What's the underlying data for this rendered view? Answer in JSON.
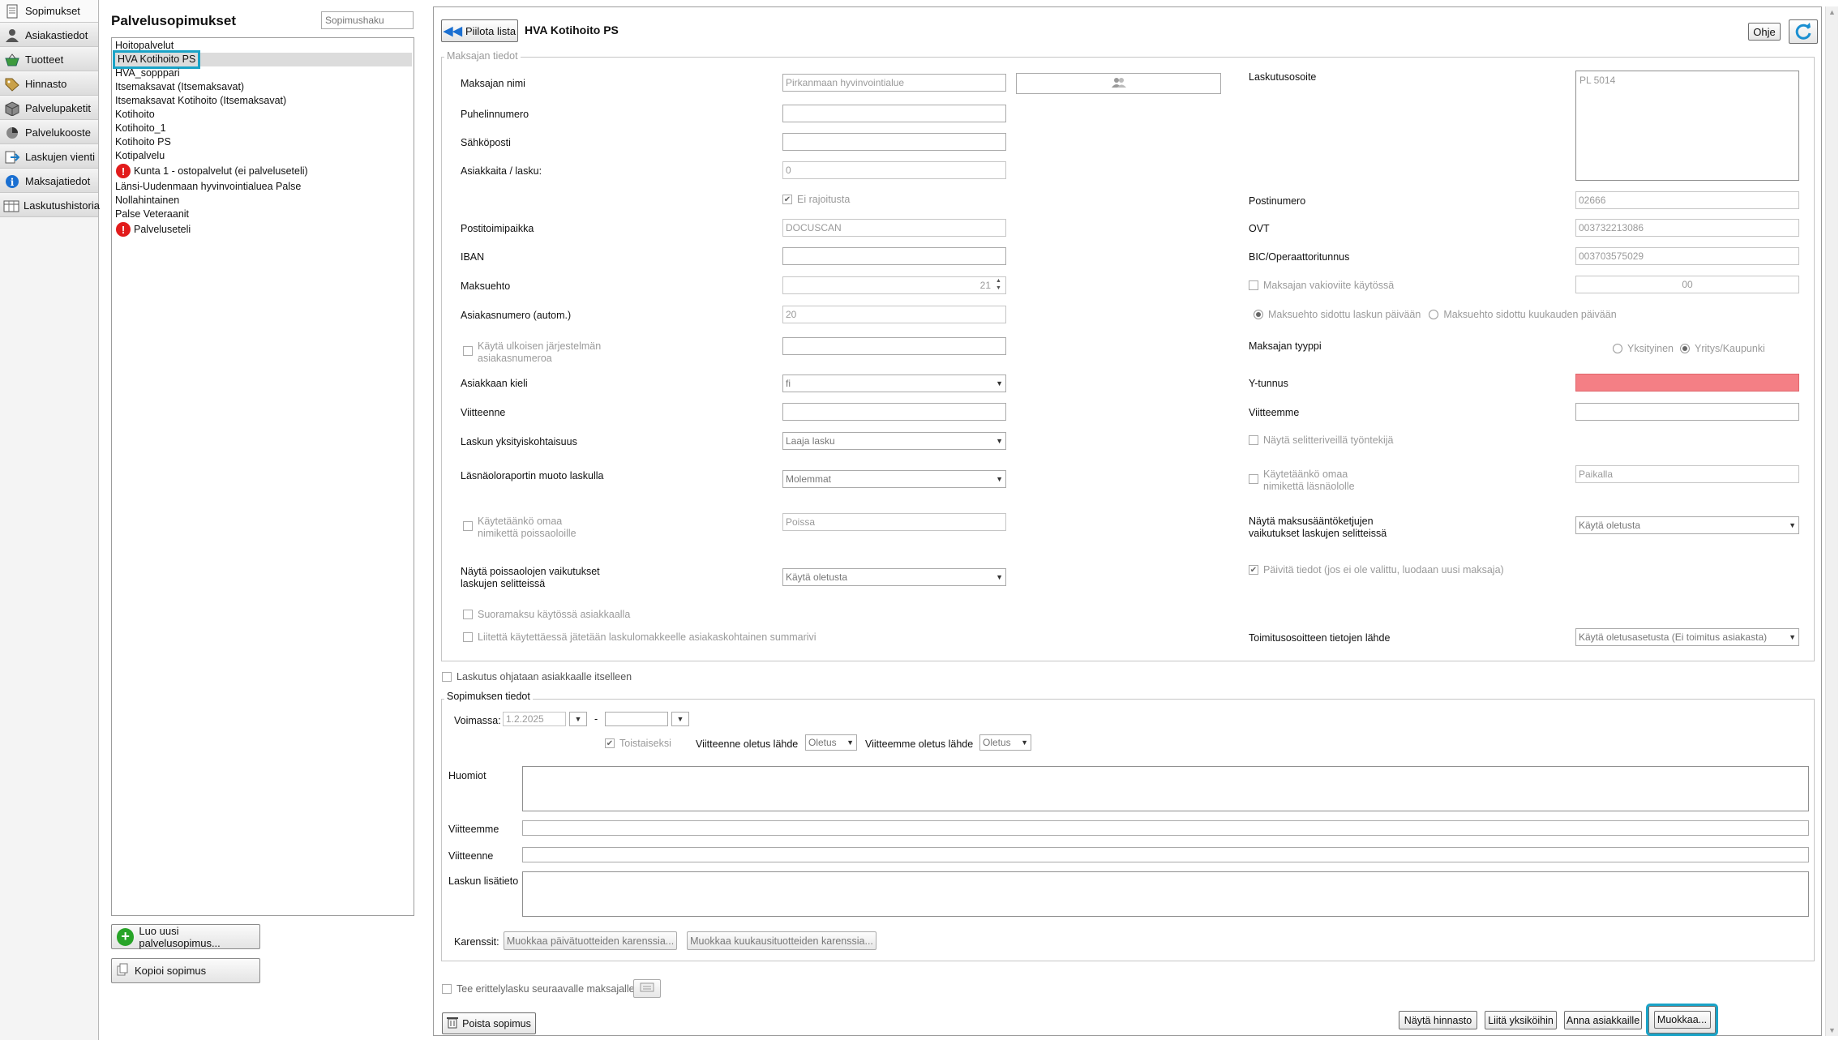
{
  "nav": {
    "items": [
      {
        "label": "Sopimukset",
        "icon": "document-icon"
      },
      {
        "label": "Asiakastiedot",
        "icon": "person-icon"
      },
      {
        "label": "Tuotteet",
        "icon": "basket-icon"
      },
      {
        "label": "Hinnasto",
        "icon": "price-tag-icon"
      },
      {
        "label": "Palvelupaketit",
        "icon": "package-icon"
      },
      {
        "label": "Palvelukooste",
        "icon": "pie-chart-icon"
      },
      {
        "label": "Laskujen vienti",
        "icon": "export-icon"
      },
      {
        "label": "Maksajatiedot",
        "icon": "info-icon"
      },
      {
        "label": "Laskutushistoria",
        "icon": "history-icon"
      }
    ]
  },
  "contracts": {
    "title": "Palvelusopimukset",
    "search_placeholder": "Sopimushaku",
    "items": [
      {
        "label": "Hoitopalvelut",
        "warning": false
      },
      {
        "label": "HVA Kotihoito PS",
        "warning": false,
        "selected": true
      },
      {
        "label": "HVA_sopppari",
        "warning": false
      },
      {
        "label": "Itsemaksavat (Itsemaksavat)",
        "warning": false
      },
      {
        "label": "Itsemaksavat Kotihoito (Itsemaksavat)",
        "warning": false
      },
      {
        "label": "Kotihoito",
        "warning": false
      },
      {
        "label": "Kotihoito_1",
        "warning": false
      },
      {
        "label": "Kotihoito PS",
        "warning": false
      },
      {
        "label": "Kotipalvelu",
        "warning": false
      },
      {
        "label": "Kunta 1 - ostopalvelut (ei palveluseteli)",
        "warning": true
      },
      {
        "label": "Länsi-Uudenmaan hyvinvointialuea Palse",
        "warning": false
      },
      {
        "label": "Nollahintainen",
        "warning": false
      },
      {
        "label": "Palse Veteraanit",
        "warning": false
      },
      {
        "label": "Palveluseteli",
        "warning": true
      }
    ],
    "new_button": "Luo uusi palvelusopimus...",
    "copy_button": "Kopioi sopimus"
  },
  "main": {
    "hide_list_button": "Piilota lista",
    "contract_title": "HVA Kotihoito PS",
    "help_button": "Ohje",
    "payer_legend": "Maksajan tiedot",
    "labels": {
      "payer_name": "Maksajan nimi",
      "phone": "Puhelinnumero",
      "email": "Sähköposti",
      "customers_per_invoice": "Asiakkaita / lasku:",
      "unlimited": "Ei rajoitusta",
      "city": "Postitoimipaikka",
      "iban": "IBAN",
      "payment_term": "Maksuehto",
      "customer_number": "Asiakasnumero (autom.)",
      "use_external": "Käytä ulkoisen järjestelmän asiakasnumeroa",
      "customer_language": "Asiakkaan kieli",
      "your_ref": "Viitteenne",
      "invoice_detail": "Laskun yksityiskohtaisuus",
      "attendance_format": "Läsnäoloraportin muoto laskulla",
      "own_name_absence": "Käytetäänkö omaa nimikettä poissaoloille",
      "show_absences": "Näytä poissaolojen vaikutukset laskujen selitteissä",
      "direct_debit": "Suoramaksu käytössä asiakkaalla",
      "attachment_summary": "Liitettä käytettäessä jätetään laskulomakkeelle asiakaskohtainen summarivi",
      "billing_address": "Laskutusosoite",
      "postal_code": "Postinumero",
      "ovt": "OVT",
      "bic": "BIC/Operaattoritunnus",
      "payer_default_ref": "Maksajan vakioviite käytössä",
      "term_invoice_date": "Maksuehto sidottu laskun päivään",
      "term_month_date": "Maksuehto sidottu kuukauden päivään",
      "payer_type": "Maksajan tyyppi",
      "private": "Yksityinen",
      "company": "Yritys/Kaupunki",
      "business_id": "Y-tunnus",
      "our_ref": "Viitteemme",
      "show_worker": "Näytä selitteriveillä työntekijä",
      "own_name_presence": "Käytetäänkö omaa nimikettä läsnäololle",
      "show_payment_rules": "Näytä maksusääntöketjujen vaikutukset laskujen selitteissä",
      "update_info": "Päivitä tiedot (jos ei ole valittu, luodaan uusi maksaja)",
      "delivery_source": "Toimitusosoitteen tietojen lähde"
    },
    "values": {
      "payer_name": "Pirkanmaan hyvinvointialue",
      "phone": "",
      "email": "",
      "customers_per_invoice": "0",
      "city": "DOCUSCAN",
      "iban": "",
      "payment_term": "21",
      "customer_number": "20",
      "external_number": "",
      "customer_language": "fi",
      "your_ref": "",
      "invoice_detail": "Laaja lasku",
      "attendance_format": "Molemmat",
      "absence_name": "Poissa",
      "show_absences": "Käytä oletusta",
      "billing_address": "PL 5014",
      "postal_code": "02666",
      "ovt": "003732213086",
      "bic": "003703575029",
      "payer_default_ref": "00",
      "business_id": "",
      "our_ref": "",
      "presence_name": "Paikalla",
      "show_payment_rules": "Käytä oletusta",
      "delivery_source": "Käytä oletusasetusta (Ei toimitus asiakasta)"
    },
    "billing_to_customer": "Laskutus ohjataan asiakkaalle itselleen",
    "contract_legend": "Sopimuksen tiedot",
    "valid_label": "Voimassa:",
    "valid_from": "1.2.2025",
    "valid_to": "",
    "until_further": "Toistaiseksi",
    "your_ref_source_label": "Viitteenne oletus lähde",
    "your_ref_source": "Oletus",
    "our_ref_source_label": "Viitteemme oletus lähde",
    "our_ref_source": "Oletus",
    "notes_label": "Huomiot",
    "our_ref_label": "Viitteemme",
    "your_ref_label": "Viitteenne",
    "extra_label": "Laskun lisätieto",
    "rounding_label": "Karenssit:",
    "edit_daily": "Muokkaa päivätuotteiden karenssia...",
    "edit_monthly": "Muokkaa kuukausituotteiden karenssia...",
    "separate_invoice": "Tee erittelylasku seuraavalle maksajalle",
    "delete_button": "Poista sopimus",
    "show_prices": "Näytä hinnasto",
    "attach_unit": "Liitä yksiköihin",
    "give_customer": "Anna asiakkaille",
    "edit_button": "Muokkaa...",
    "highlight_color": "#1aa3c7",
    "error_color": "#f47f85"
  }
}
